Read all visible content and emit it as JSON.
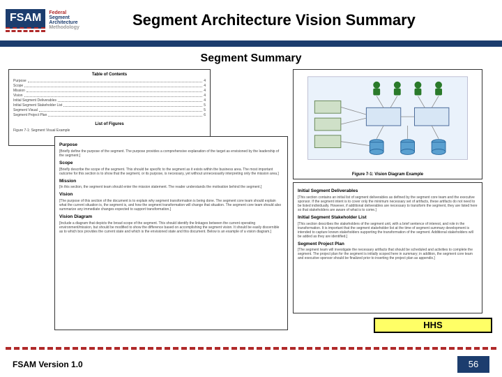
{
  "header": {
    "logo": {
      "badge": "FSAM",
      "line1": "Federal",
      "line2": "Segment",
      "line3": "Architecture",
      "line4": "Methodology"
    },
    "title": "Segment Architecture Vision Summary"
  },
  "sub_title": "Segment Summary",
  "documents": {
    "toc": {
      "heading": "Table of Contents",
      "items": [
        {
          "label": "Purpose",
          "page": "4"
        },
        {
          "label": "Scope",
          "page": "4"
        },
        {
          "label": "Mission",
          "page": "4"
        },
        {
          "label": "Vision",
          "page": "4"
        },
        {
          "label": "Initial Segment Deliverables",
          "page": "4"
        },
        {
          "label": "Initial Segment Stakeholder List",
          "page": "5"
        },
        {
          "label": "Segment Visual",
          "page": "5"
        },
        {
          "label": "Segment Project Plan",
          "page": "6"
        }
      ],
      "figures_heading": "List of Figures",
      "figures_item": "Figure 7-1: Segment Visual Example"
    },
    "body1": {
      "sections": [
        {
          "h": "Purpose",
          "t": "[Briefly define the purpose of the segment. The purpose provides a comprehensive explanation of the target as envisioned by the leadership of the segment.]"
        },
        {
          "h": "Scope",
          "t": "[Briefly describe the scope of the segment. This should be specific to the segment as it exists within the business area. The most important outcome for this section is to show that the segment, or its purpose, is necessary, yet without unnecessarily interpreting only the mission area.]"
        },
        {
          "h": "Mission",
          "t": "[In this section, the segment team should enter the mission statement. The reader understands the motivation behind the segment.]"
        },
        {
          "h": "Vision",
          "t": "[The purpose of this section of the document is to explain why segment transformation is being done. The segment core team should explain what the current situation is, the segment is, and how the segment transformation will change that situation. The segment core team should also summarize any immediate changes expected to support transformation.]"
        },
        {
          "h": "Vision Diagram",
          "t": "[Include a diagram that depicts the broad scope of the segment. This should identify the linkages between the current operating environment/mission, but should be modified to show the difference based on accomplishing the segment vision. It should be easily discernible as to which box provides the current state and which is the envisioned state and this document. Below is an example of a vision diagram.]"
        }
      ]
    },
    "diagram": {
      "caption": "Figure 7-1: Vision Diagram Example"
    },
    "body2": {
      "sections": [
        {
          "h": "Initial Segment Deliverables",
          "t": "[This section contains an initial list of segment deliverables as defined by the segment core team and the executive sponsor. If the segment intent is to cover only the minimum necessary set of artifacts, these artifacts do not need to be listed individually. However, if additional deliverables are necessary to transform the segment, they are listed here so that stakeholders are aware of what is to come.]"
        },
        {
          "h": "Initial Segment Stakeholder List",
          "t": "[This section describes the stakeholders of the segment unit, with a brief sentence of interest, and role in the transformation. It is important that the segment stakeholder list at the time of segment summary development is intended to capture known stakeholders supporting the transformation of the segment. Additional stakeholders will be added as they are identified.]"
        },
        {
          "h": "Segment Project Plan",
          "t": "[The segment team will investigate the necessary artifacts that should be scheduled and activities to complete the segment. The project plan for the segment is initially scoped here in summary; in addition, the segment core team and executive sponsor should be finalized prior to inserting the project plan as appendix.]"
        }
      ]
    }
  },
  "hhs_label": "HHS",
  "footer": {
    "version": "FSAM Version 1.0",
    "page": "56"
  }
}
